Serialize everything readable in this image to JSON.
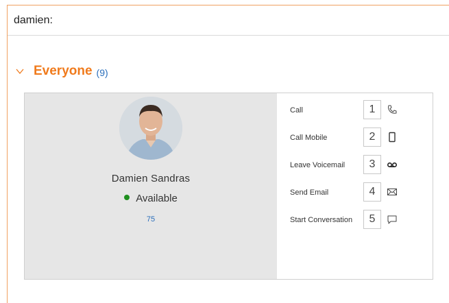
{
  "search": {
    "value": "damien:"
  },
  "group": {
    "name": "Everyone",
    "count": "(9)"
  },
  "contact": {
    "name": "Damien Sandras",
    "status": "Available",
    "extension": "75",
    "status_color": "#1f8f1f"
  },
  "actions": [
    {
      "label": "Call",
      "key": "1",
      "icon": "phone-icon"
    },
    {
      "label": "Call Mobile",
      "key": "2",
      "icon": "mobile-icon"
    },
    {
      "label": "Leave Voicemail",
      "key": "3",
      "icon": "voicemail-icon"
    },
    {
      "label": "Send Email",
      "key": "4",
      "icon": "email-icon"
    },
    {
      "label": "Start Conversation",
      "key": "5",
      "icon": "chat-icon"
    }
  ],
  "colors": {
    "accent": "#f07b1d",
    "link": "#2a6ebb",
    "panel": "#e6e6e6"
  }
}
